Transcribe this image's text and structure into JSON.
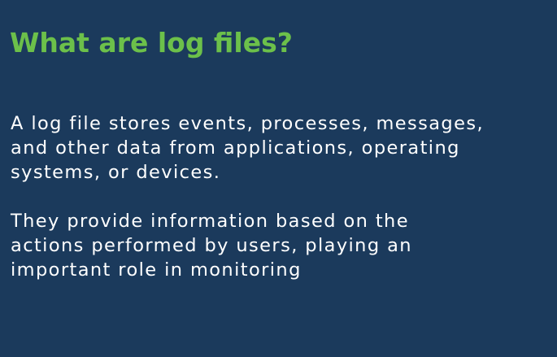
{
  "slide": {
    "title": "What are log files?",
    "title_color": "#6cc04a",
    "background_color": "#1b3a5c",
    "text_color": "#ffffff",
    "paragraphs": [
      {
        "lines": [
          "A log file stores events, processes, messages,",
          "and other data from applications, operating",
          "systems, or devices."
        ]
      },
      {
        "lines": [
          "They provide information based on the",
          "actions performed by users, playing an",
          "important role in monitoring"
        ]
      }
    ]
  }
}
